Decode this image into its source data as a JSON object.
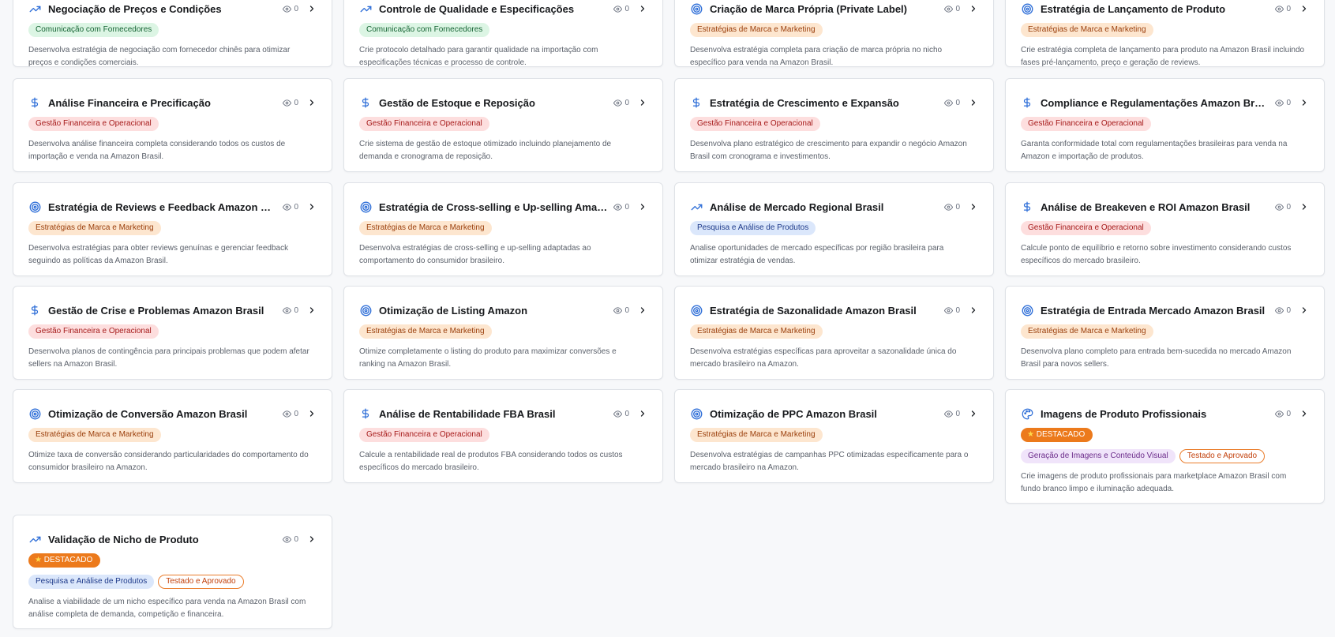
{
  "colors": {
    "page_bg": "#f7f8fa",
    "card_border": "#dfe2e7",
    "icon_blue": "#2f6fd8",
    "featured_orange": "#ec7a1c"
  },
  "cards": [
    {
      "title": "Negociação de Preços e Condições",
      "icon": "trend-icon",
      "views": "0",
      "badges": [
        {
          "label": "Comunicação com Fornecedores",
          "style": "green"
        }
      ],
      "description": [
        "Desenvolva estratégia de negociação com fornecedor chinês para otimizar",
        "preços e condições comerciais."
      ]
    },
    {
      "title": "Controle de Qualidade e Especificações",
      "icon": "trend-icon",
      "views": "0",
      "badges": [
        {
          "label": "Comunicação com Fornecedores",
          "style": "green"
        }
      ],
      "description": [
        "Crie protocolo detalhado para garantir qualidade na importação com",
        "especificações técnicas e processo de controle."
      ]
    },
    {
      "title": "Criação de Marca Própria (Private Label)",
      "icon": "target-icon",
      "views": "0",
      "badges": [
        {
          "label": "Estratégias de Marca e Marketing",
          "style": "orange"
        }
      ],
      "description": [
        "Desenvolva estratégia completa para criação de marca própria no nicho",
        "específico para venda na Amazon Brasil."
      ]
    },
    {
      "title": "Estratégia de Lançamento de Produto",
      "icon": "target-icon",
      "views": "0",
      "badges": [
        {
          "label": "Estratégias de Marca e Marketing",
          "style": "orange"
        }
      ],
      "description": [
        "Crie estratégia completa de lançamento para produto na Amazon Brasil incluindo",
        "fases pré-lançamento, preço e geração de reviews."
      ]
    },
    {
      "title": "Análise Financeira e Precificação",
      "icon": "dollar-icon",
      "views": "0",
      "badges": [
        {
          "label": "Gestão Financeira e Operacional",
          "style": "red"
        }
      ],
      "description": [
        "Desenvolva análise financeira completa considerando todos os custos de",
        "importação e venda na Amazon Brasil."
      ]
    },
    {
      "title": "Gestão de Estoque e Reposição",
      "icon": "dollar-icon",
      "views": "0",
      "badges": [
        {
          "label": "Gestão Financeira e Operacional",
          "style": "red"
        }
      ],
      "description": [
        "Crie sistema de gestão de estoque otimizado incluindo planejamento de",
        "demanda e cronograma de reposição."
      ]
    },
    {
      "title": "Estratégia de Crescimento e Expansão",
      "icon": "dollar-icon",
      "views": "0",
      "badges": [
        {
          "label": "Gestão Financeira e Operacional",
          "style": "red"
        }
      ],
      "description": [
        "Desenvolva plano estratégico de crescimento para expandir o negócio Amazon",
        "Brasil com cronograma e investimentos."
      ]
    },
    {
      "title": "Compliance e Regulamentações Amazon Brasil",
      "icon": "dollar-icon",
      "views": "0",
      "badges": [
        {
          "label": "Gestão Financeira e Operacional",
          "style": "red"
        }
      ],
      "description": [
        "Garanta conformidade total com regulamentações brasileiras para venda na",
        "Amazon e importação de produtos."
      ]
    },
    {
      "title": "Estratégia de Reviews e Feedback Amazon Brasil",
      "icon": "target-icon",
      "views": "0",
      "badges": [
        {
          "label": "Estratégias de Marca e Marketing",
          "style": "orange"
        }
      ],
      "description": [
        "Desenvolva estratégias para obter reviews genuínas e gerenciar feedback",
        "seguindo as políticas da Amazon Brasil."
      ]
    },
    {
      "title": "Estratégia de Cross-selling e Up-selling Amazon Brasil",
      "icon": "target-icon",
      "views": "0",
      "badges": [
        {
          "label": "Estratégias de Marca e Marketing",
          "style": "orange"
        }
      ],
      "description": [
        "Desenvolva estratégias de cross-selling e up-selling adaptadas ao",
        "comportamento do consumidor brasileiro."
      ]
    },
    {
      "title": "Análise de Mercado Regional Brasil",
      "icon": "trend-icon",
      "views": "0",
      "badges": [
        {
          "label": "Pesquisa e Análise de Produtos",
          "style": "blue"
        }
      ],
      "description": [
        "Analise oportunidades de mercado específicas por região brasileira para",
        "otimizar estratégia de vendas."
      ]
    },
    {
      "title": "Análise de Breakeven e ROI Amazon Brasil",
      "icon": "dollar-icon",
      "views": "0",
      "badges": [
        {
          "label": "Gestão Financeira e Operacional",
          "style": "red"
        }
      ],
      "description": [
        "Calcule ponto de equilíbrio e retorno sobre investimento considerando custos",
        "específicos do mercado brasileiro."
      ]
    },
    {
      "title": "Gestão de Crise e Problemas Amazon Brasil",
      "icon": "dollar-icon",
      "views": "0",
      "badges": [
        {
          "label": "Gestão Financeira e Operacional",
          "style": "red"
        }
      ],
      "description": [
        "Desenvolva planos de contingência para principais problemas que podem afetar",
        "sellers na Amazon Brasil."
      ]
    },
    {
      "title": "Otimização de Listing Amazon",
      "icon": "target-icon",
      "views": "0",
      "badges": [
        {
          "label": "Estratégias de Marca e Marketing",
          "style": "orange"
        }
      ],
      "description": [
        "Otimize completamente o listing do produto para maximizar conversões e",
        "ranking na Amazon Brasil."
      ]
    },
    {
      "title": "Estratégia de Sazonalidade Amazon Brasil",
      "icon": "target-icon",
      "views": "0",
      "badges": [
        {
          "label": "Estratégias de Marca e Marketing",
          "style": "orange"
        }
      ],
      "description": [
        "Desenvolva estratégias específicas para aproveitar a sazonalidade única do",
        "mercado brasileiro na Amazon."
      ]
    },
    {
      "title": "Estratégia de Entrada Mercado Amazon Brasil",
      "icon": "target-icon",
      "views": "0",
      "badges": [
        {
          "label": "Estratégias de Marca e Marketing",
          "style": "orange"
        }
      ],
      "description": [
        "Desenvolva plano completo para entrada bem-sucedida no mercado Amazon",
        "Brasil para novos sellers."
      ]
    },
    {
      "title": "Otimização de Conversão Amazon Brasil",
      "icon": "target-icon",
      "views": "0",
      "badges": [
        {
          "label": "Estratégias de Marca e Marketing",
          "style": "orange"
        }
      ],
      "description": [
        "Otimize taxa de conversão considerando particularidades do comportamento do",
        "consumidor brasileiro na Amazon."
      ]
    },
    {
      "title": "Análise de Rentabilidade FBA Brasil",
      "icon": "dollar-icon",
      "views": "0",
      "badges": [
        {
          "label": "Gestão Financeira e Operacional",
          "style": "red"
        }
      ],
      "description": [
        "Calcule a rentabilidade real de produtos FBA considerando todos os custos",
        "específicos do mercado brasileiro."
      ]
    },
    {
      "title": "Otimização de PPC Amazon Brasil",
      "icon": "target-icon",
      "views": "0",
      "badges": [
        {
          "label": "Estratégias de Marca e Marketing",
          "style": "orange"
        }
      ],
      "description": [
        "Desenvolva estratégias de campanhas PPC otimizadas especificamente para o",
        "mercado brasileiro na Amazon."
      ]
    },
    {
      "title": "Imagens de Produto Profissionais",
      "icon": "palette-icon",
      "views": "0",
      "featured": "DESTACADO",
      "badges": [
        {
          "label": "Geração de Imagens e Conteúdo Visual",
          "style": "purple"
        },
        {
          "label": "Testado e Aprovado",
          "style": "outline"
        }
      ],
      "description": [
        "Crie imagens de produto profissionais para marketplace Amazon Brasil com",
        "fundo branco limpo e iluminação adequada."
      ]
    },
    {
      "title": "Validação de Nicho de Produto",
      "icon": "trend-icon",
      "views": "0",
      "featured": "DESTACADO",
      "badges": [
        {
          "label": "Pesquisa e Análise de Produtos",
          "style": "blue"
        },
        {
          "label": "Testado e Aprovado",
          "style": "outline"
        }
      ],
      "description": [
        "Analise a viabilidade de um nicho específico para venda na Amazon Brasil com",
        "análise completa de demanda, competição e financeira."
      ]
    }
  ]
}
